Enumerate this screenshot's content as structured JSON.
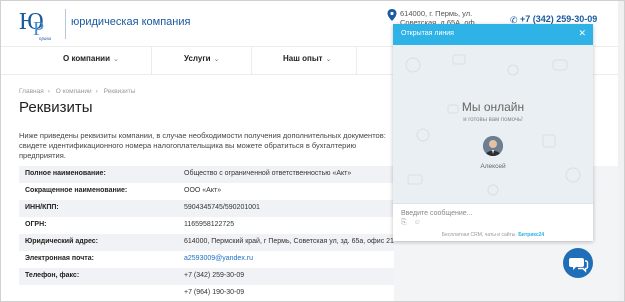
{
  "header": {
    "company_name": "юридическая компания",
    "address_line1": "614000, г. Пермь, ул.",
    "address_line2": "Советская, д.65А, оф.",
    "phone": "+7 (342) 259-30-09"
  },
  "nav": {
    "items": [
      {
        "label": "О компании"
      },
      {
        "label": "Услуги"
      },
      {
        "label": "Наш опыт"
      }
    ]
  },
  "breadcrumbs": [
    "Главная",
    "О компании",
    "Реквизиты"
  ],
  "page_title": "Реквизиты",
  "intro": "Ниже приведены реквизиты компании, в случае необходимости получения дополнительных документов: свидете идентификационного номера налогоплательщика вы можете обратиться в бухгалтерию предприятия.",
  "requisites": [
    {
      "key": "Полное наименование:",
      "value": "Общество с ограниченной ответственностью «Акт»"
    },
    {
      "key": "Сокращенное наименование:",
      "value": "ООО «Акт»"
    },
    {
      "key": "ИНН/КПП:",
      "value": "5904345745/590201001"
    },
    {
      "key": "ОГРН:",
      "value": "1165958122725"
    },
    {
      "key": "Юридический адрес:",
      "value": "614000, Пермский край, г Пермь, Советская ул, зд. 65а, офис 211, домофон 11"
    },
    {
      "key": "Электронная почта:",
      "value": "a2593009@yandex.ru"
    },
    {
      "key": "Телефон, факс:",
      "value": "+7 (342) 259-30-09"
    },
    {
      "key": "",
      "value": "+7 (964) 190-30-09"
    }
  ],
  "chat": {
    "header_title": "Открытая линия",
    "online_title": "Мы онлайн",
    "online_sub": "и готовы вам помочь!",
    "agent_name": "Алексей",
    "input_placeholder": "Введите сообщение...",
    "footer_text": "Бесплатная CRM, чаты и сайты.",
    "footer_brand": "Битрикс24"
  },
  "colors": {
    "brand": "#1a5aa0",
    "chat_accent": "#2fb3e6",
    "fab": "#1e6fb8"
  }
}
